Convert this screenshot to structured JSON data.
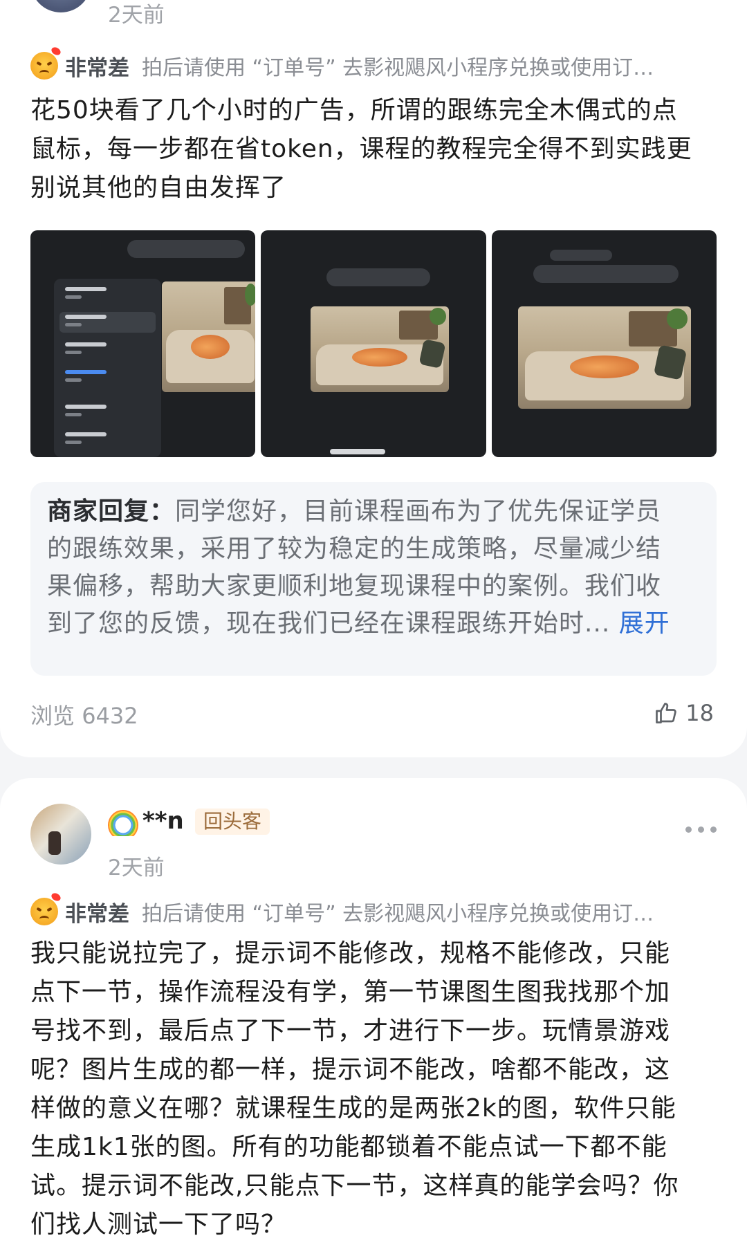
{
  "review1": {
    "time": "2天前",
    "rating_label": "非常差",
    "rating_note": "拍后请使用 “订单号” 去影视飓风小程序兑换或使用订…",
    "body_lines": [
      "花50块看了几个小时的广告，所谓的跟练完全木偶式的点",
      "鼠标，每一步都在省token，课程的教程完全得不到实践更",
      "别说其他的自由发挥了"
    ],
    "merchant_reply": {
      "label": "商家回复：",
      "lines": [
        "同学您好，目前课程画布为了优先保证学员",
        "的跟练效果，采用了较为稳定的生成策略，尽量减少结",
        "果偏移，帮助大家更顺利地复现课程中的案例。我们收",
        "到了您的反馈，现在我们已经在课程跟练开始时..."
      ],
      "expand": "展开"
    },
    "views_label": "浏览",
    "views": "6432",
    "likes": "18"
  },
  "review2": {
    "username": "**n",
    "badge": "回头客",
    "time": "2天前",
    "rating_label": "非常差",
    "rating_note": "拍后请使用 “订单号” 去影视飓风小程序兑换或使用订…",
    "body_lines": [
      "我只能说拉完了，提示词不能修改，规格不能修改，只能",
      "点下一节，操作流程没有学，第一节课图生图我找那个加",
      "号找不到，最后点了下一节，才进行下一步。玩情景游戏",
      "呢？图片生成的都一样，提示词不能改，啥都不能改，这",
      "样做的意义在哪？就课程生成的是两张2k的图，软件只能",
      "生成1k1张的图。所有的功能都锁着不能点试一下都不能",
      "试。提示词不能改,只能点下一节，这样真的能学会吗？你",
      "们找人测试一下了吗？"
    ]
  }
}
